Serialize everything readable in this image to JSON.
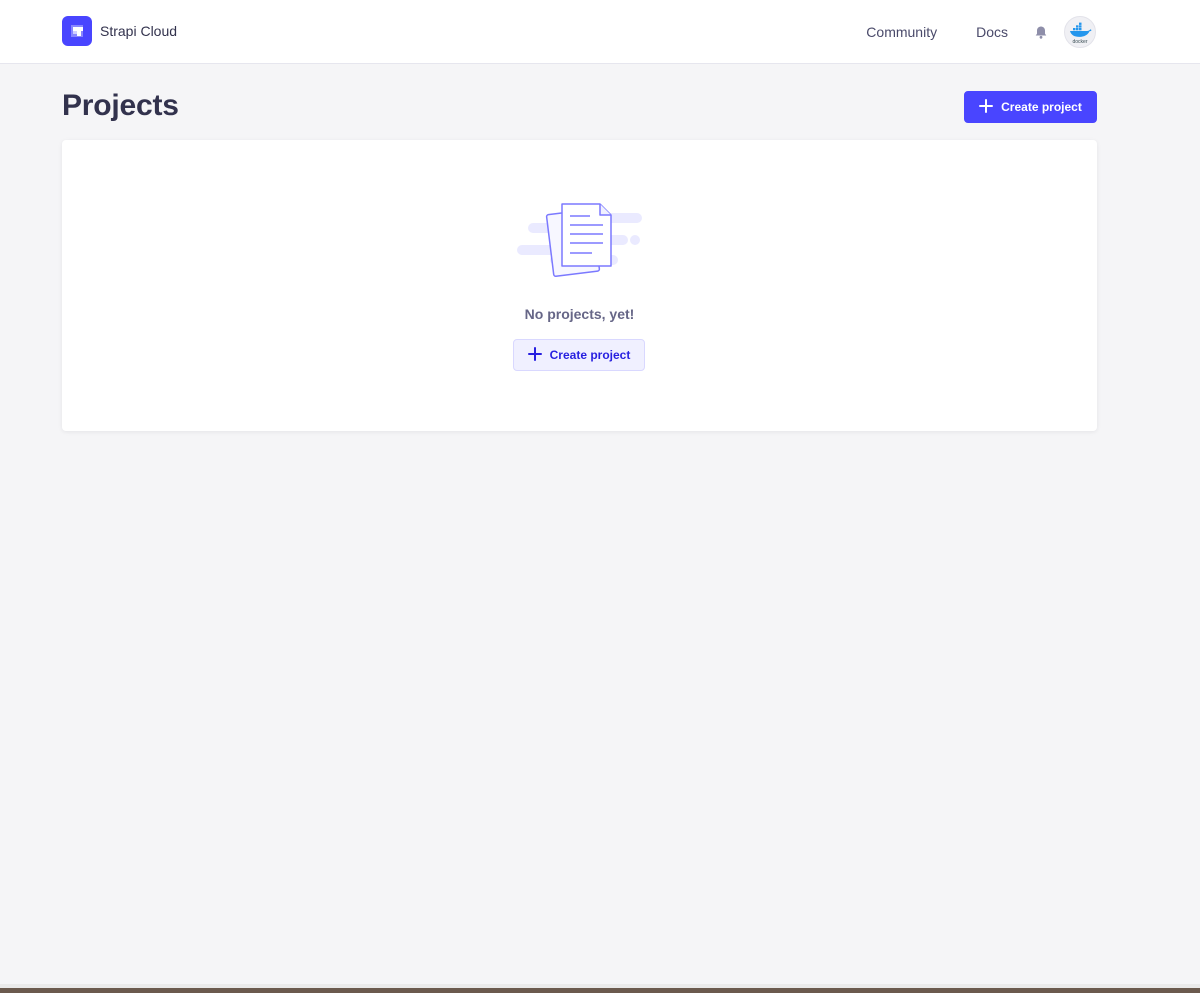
{
  "header": {
    "brand_name": "Strapi Cloud",
    "nav": {
      "community": "Community",
      "docs": "Docs"
    },
    "icons": {
      "notifications": "bell-icon",
      "avatar": "docker-avatar"
    },
    "avatar_text": "docker"
  },
  "main": {
    "title": "Projects",
    "create_button_label": "Create project",
    "empty_state": {
      "message": "No projects, yet!",
      "button_label": "Create project",
      "illustration": "documents-illustration"
    }
  },
  "colors": {
    "primary": "#4945ff",
    "primary_light": "#f0f0ff",
    "background": "#f5f5f7",
    "text_dark": "#32324d",
    "text_muted": "#666687"
  }
}
